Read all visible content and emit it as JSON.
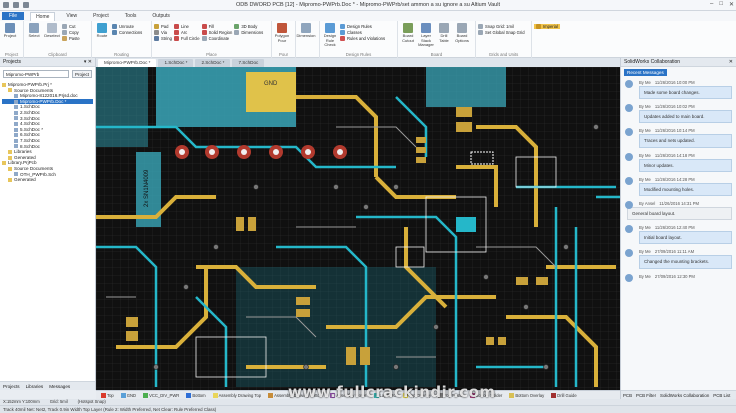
{
  "window": {
    "title": "ODB DWORD PCB [12] - Mipromo-PWPrb.Doc * - Mipromo-PWPrb/set ammon a su ignore a su Altium Vault",
    "controls": [
      "–",
      "□",
      "✕"
    ]
  },
  "menu": {
    "file": "File",
    "tabs": [
      "Home",
      "View",
      "Project",
      "Tools",
      "Outputs"
    ],
    "active": "Home"
  },
  "ribbon": {
    "groups": [
      {
        "label": "Project",
        "buttons": [
          "Project"
        ]
      },
      {
        "label": "Clipboard",
        "buttons": [
          "Select",
          "Deselect"
        ],
        "small": [
          "Cut",
          "Copy",
          "Paste"
        ]
      },
      {
        "label": "Routing",
        "buttons": [
          "Route"
        ],
        "small": [
          "Unroute",
          "Connections"
        ]
      },
      {
        "label": "Place",
        "small": [
          "Pad",
          "Via",
          "String",
          "Line",
          "Arc",
          "Full Circle",
          "Fill",
          "Solid Region",
          "Coordinate",
          "3D Body",
          "Dimensions"
        ]
      },
      {
        "label": "Pour",
        "buttons": [
          "Polygon Pour"
        ]
      },
      {
        "label": "",
        "buttons": [
          "Dimension"
        ]
      },
      {
        "label": "Design Rules",
        "buttons": [
          "Design Rule Check"
        ],
        "small": [
          "Design Rules",
          "Classes",
          "Rules and Violations"
        ]
      },
      {
        "label": "Board",
        "buttons": [
          "Board Cutout",
          "Layer Stack Manager",
          "Drill Table",
          "Board Options"
        ]
      },
      {
        "label": "Grids and Units",
        "small": [
          "Snap Grid: 1mil",
          "Set Global Snap Grid"
        ]
      },
      {
        "label": "",
        "small": [
          "Imperial"
        ]
      }
    ]
  },
  "left_panel": {
    "header": "Projects",
    "project_input": "Mipromo-PWPrb",
    "project_button": "Project",
    "tree": [
      {
        "label": "Mipromo-PWPrb.Prj *",
        "level": 0,
        "selected": false
      },
      {
        "label": "Source Documents",
        "level": 1,
        "selected": false
      },
      {
        "label": "Mipromo-8122016.Prjsd.doc",
        "level": 2,
        "selected": false
      },
      {
        "label": "Mipromo-PWPrb.Doc *",
        "level": 2,
        "selected": true
      },
      {
        "label": "1.SchDoc",
        "level": 2,
        "selected": false
      },
      {
        "label": "2.SchDoc",
        "level": 2,
        "selected": false
      },
      {
        "label": "3.SchDoc",
        "level": 2,
        "selected": false
      },
      {
        "label": "4.SchDoc",
        "level": 2,
        "selected": false
      },
      {
        "label": "5.SchDoc *",
        "level": 2,
        "selected": false
      },
      {
        "label": "6.SchDoc",
        "level": 2,
        "selected": false
      },
      {
        "label": "7.SchDoc",
        "level": 2,
        "selected": false
      },
      {
        "label": "8.SchDoc",
        "level": 2,
        "selected": false
      },
      {
        "label": "Libraries",
        "level": 1,
        "selected": false
      },
      {
        "label": "Generated",
        "level": 1,
        "selected": false
      },
      {
        "label": "Library.PrjPcb",
        "level": 0,
        "selected": false
      },
      {
        "label": "Source Documents",
        "level": 1,
        "selected": false
      },
      {
        "label": "OTH_PWPrb.Sch",
        "level": 2,
        "selected": false
      },
      {
        "label": "Generated",
        "level": 1,
        "selected": false
      }
    ],
    "footer_tabs": [
      "Projects",
      "Libraries",
      "Messages"
    ]
  },
  "doc_tabs": [
    "Mipromo-PWPrb.Doc *",
    "1.SchDoc *",
    "2.SchDoc *",
    "7.SchDoc"
  ],
  "board": {
    "chip_label": "GND",
    "ic_label": "2x SN1N4009",
    "colors": {
      "bg": "#101010",
      "trace_yellow": "#d9b03a",
      "trace_cyan": "#25b7c9",
      "pad_gray": "#9a9a9a",
      "pad_red": "#c0392b",
      "grid": "#3a3a3a"
    }
  },
  "layers": [
    {
      "name": "Top",
      "color": "#d93a2b"
    },
    {
      "name": "GND",
      "color": "#5aa0d8"
    },
    {
      "name": "VCC_DIV_PWR",
      "color": "#4caf50"
    },
    {
      "name": "Bottom",
      "color": "#2f6fd6"
    },
    {
      "name": "Assembly Drawing Top",
      "color": "#e9d55a"
    },
    {
      "name": "Assembly Drawing Bottom",
      "color": "#c78d3a"
    },
    {
      "name": "Assembly Notes",
      "color": "#9b59b6"
    },
    {
      "name": "Layer 20",
      "color": "#3bb9b6"
    },
    {
      "name": "Top Overlay",
      "color": "#f0e060"
    },
    {
      "name": "Top Paste",
      "color": "#888888"
    },
    {
      "name": "Bottom Solder",
      "color": "#b8488a"
    },
    {
      "name": "Bottom Overlay",
      "color": "#d8c055"
    },
    {
      "name": "Drill Guide",
      "color": "#a03030"
    }
  ],
  "right_panel": {
    "header": "SolidWorks Collaboration",
    "tabs": [
      "Recent Messages"
    ],
    "messages": [
      {
        "author": "By Me",
        "date": "11/26/2016 10:00 PM",
        "text": "Made some board changes.",
        "alt": false
      },
      {
        "author": "By Me",
        "date": "11/26/2016 10:02 PM",
        "text": "Updates added to main board.",
        "alt": false
      },
      {
        "author": "By Me",
        "date": "11/26/2016 10:14 PM",
        "text": "Traces and nets updated.",
        "alt": false
      },
      {
        "author": "By Me",
        "date": "11/26/2016 14:18 PM",
        "text": "Minor updates.",
        "alt": false
      },
      {
        "author": "By Me",
        "date": "11/26/2016 14:28 PM",
        "text": "Modified mounting holes.",
        "alt": false
      },
      {
        "author": "By Ansel",
        "date": "11/26/2016 14:31 PM",
        "text": "General board layout.",
        "alt": true
      },
      {
        "author": "By Me",
        "date": "11/26/2016 12:40 PM",
        "text": "Initial board layout.",
        "alt": false
      },
      {
        "author": "By Me",
        "date": "27/09/2016 11:11 AM",
        "text": "Changed the mounting brackets.",
        "alt": false
      },
      {
        "author": "By Me",
        "date": "27/09/2016 12:30 PM",
        "text": "",
        "alt": false
      }
    ],
    "bottom_tabs": [
      "PCB",
      "PCB Filter",
      "SolidWorks Collaboration",
      "PCB List"
    ]
  },
  "status": {
    "line1": [
      "X:152mm  Y:100mm",
      "Grid: 5mil",
      "(Hotspot Snap)"
    ],
    "line2": [
      "Track 40mil Net: Net2, Track 0.9in Width Top Layer (Rule 2: Width Preferred, Net Clear: Rule Preferred Class)"
    ]
  },
  "watermark": "www.fullcrackindir.com"
}
